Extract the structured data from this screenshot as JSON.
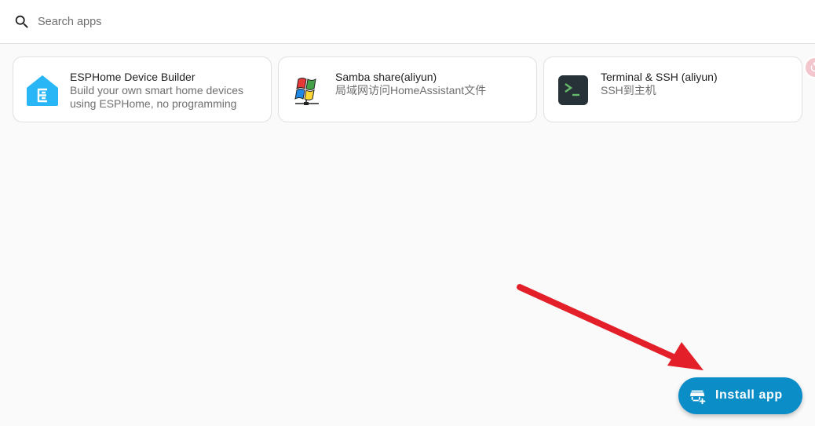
{
  "search": {
    "placeholder": "Search apps",
    "value": ""
  },
  "apps": [
    {
      "title": "ESPHome Device Builder",
      "description": "Build your own smart home devices using ESPHome, no programming",
      "icon": "esphome-logo-icon"
    },
    {
      "title": "Samba share(aliyun)",
      "description": "局域网访问HomeAssistant文件",
      "icon": "samba-windows-share-icon"
    },
    {
      "title": "Terminal & SSH (aliyun)",
      "description": "SSH到主机",
      "icon": "terminal-icon"
    }
  ],
  "fab": {
    "label": "Install app",
    "icon": "store-plus-icon"
  },
  "colors": {
    "accent": "#0b8dc7",
    "annotation_arrow": "#e3202a",
    "esphome_blue": "#29b6f6"
  }
}
